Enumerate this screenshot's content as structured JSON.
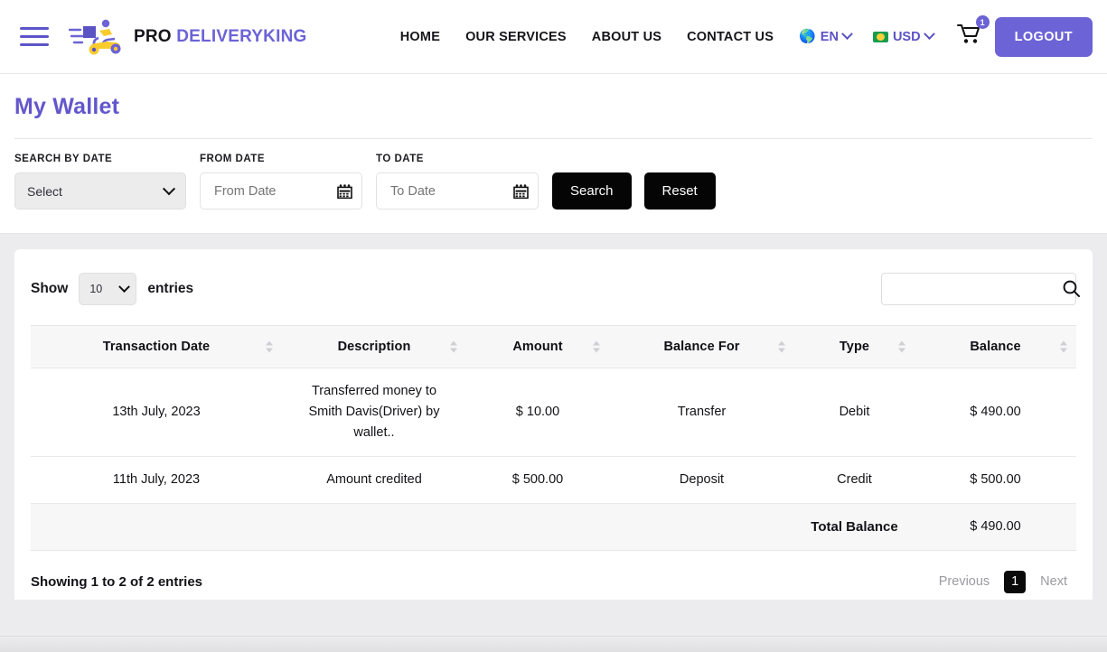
{
  "header": {
    "menu_icon": "hamburger-icon",
    "brand": {
      "part1": "PRO",
      "part2": "DELIVERYKING"
    },
    "nav": [
      {
        "label": "HOME"
      },
      {
        "label": "OUR SERVICES"
      },
      {
        "label": "ABOUT US"
      },
      {
        "label": "CONTACT US"
      }
    ],
    "language": {
      "label": "EN",
      "icon": "globe-icon"
    },
    "currency": {
      "label": "USD",
      "icon": "flag-icon"
    },
    "cart": {
      "icon": "cart-icon",
      "badge": "1"
    },
    "logout_label": "LOGOUT",
    "accent_color": "#6c63d6"
  },
  "page": {
    "title": "My Wallet",
    "title_color": "#6257cc"
  },
  "filters": {
    "search_by_date": {
      "label": "SEARCH BY DATE",
      "value": "Select"
    },
    "from_date": {
      "label": "FROM DATE",
      "value": "",
      "placeholder": "From Date",
      "icon": "calendar-icon"
    },
    "to_date": {
      "label": "TO DATE",
      "value": "",
      "placeholder": "To Date",
      "icon": "calendar-icon"
    },
    "search_button": "Search",
    "reset_button": "Reset"
  },
  "table_controls": {
    "show_label": "Show",
    "page_length": "10",
    "entries_label": "entries",
    "search": {
      "value": "",
      "placeholder": "",
      "icon": "search-icon"
    }
  },
  "table": {
    "columns": [
      "Transaction Date",
      "Description",
      "Amount",
      "Balance For",
      "Type",
      "Balance"
    ],
    "rows": [
      {
        "transaction_date": "13th July, 2023",
        "description": "Transferred money to Smith Davis(Driver) by wallet..",
        "amount": "$ 10.00",
        "balance_for": "Transfer",
        "type": "Debit",
        "balance": "$ 490.00"
      },
      {
        "transaction_date": "11th July, 2023",
        "description": "Amount credited",
        "amount": "$ 500.00",
        "balance_for": "Deposit",
        "type": "Credit",
        "balance": "$ 500.00"
      }
    ],
    "total": {
      "label": "Total Balance",
      "value": "$ 490.00"
    }
  },
  "footer": {
    "showing": "Showing 1 to 2 of 2 entries",
    "previous": "Previous",
    "current_page": "1",
    "next": "Next"
  }
}
